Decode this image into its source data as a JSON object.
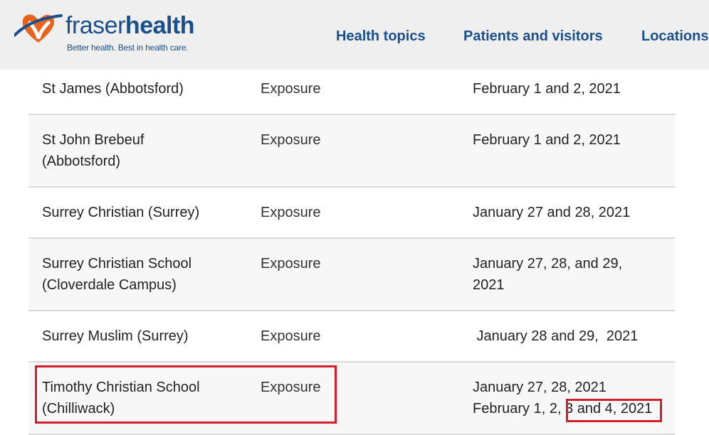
{
  "header": {
    "logo": {
      "name_part1": "fraser",
      "name_part2": "health",
      "tagline": "Better health. Best in health care."
    },
    "nav": [
      {
        "label": "Health topics"
      },
      {
        "label": "Patients and visitors"
      },
      {
        "label": "Locations"
      }
    ]
  },
  "table": {
    "rows": [
      {
        "school": " St James (Abbotsford)",
        "type": "Exposure",
        "date": " February 1 and 2, 2021"
      },
      {
        "school": " St John Brebeuf\n(Abbotsford)",
        "type": "Exposure",
        "date": " February 1 and 2, 2021"
      },
      {
        "school": " Surrey Christian (Surrey)",
        "type": "Exposure",
        "date": " January 27 and 28, 2021"
      },
      {
        "school": " Surrey Christian School\n(Cloverdale Campus)",
        "type": "Exposure",
        "date": " January 27, 28, and 29,\n2021"
      },
      {
        "school": " Surrey Muslim (Surrey)",
        "type": "Exposure",
        "date": " January 28 and 29,  2021"
      },
      {
        "school": " Timothy Christian School\n(Chilliwack)",
        "type": "Exposure",
        "date_line1": " January 27, 28, 2021",
        "date_line2_a": " February 1, 2, ",
        "date_line2_b": "3 and 4, 2021"
      }
    ]
  },
  "colors": {
    "brand": "#1a4f8b",
    "accent_orange": "#e8641c",
    "highlight": "#d21f2b"
  }
}
